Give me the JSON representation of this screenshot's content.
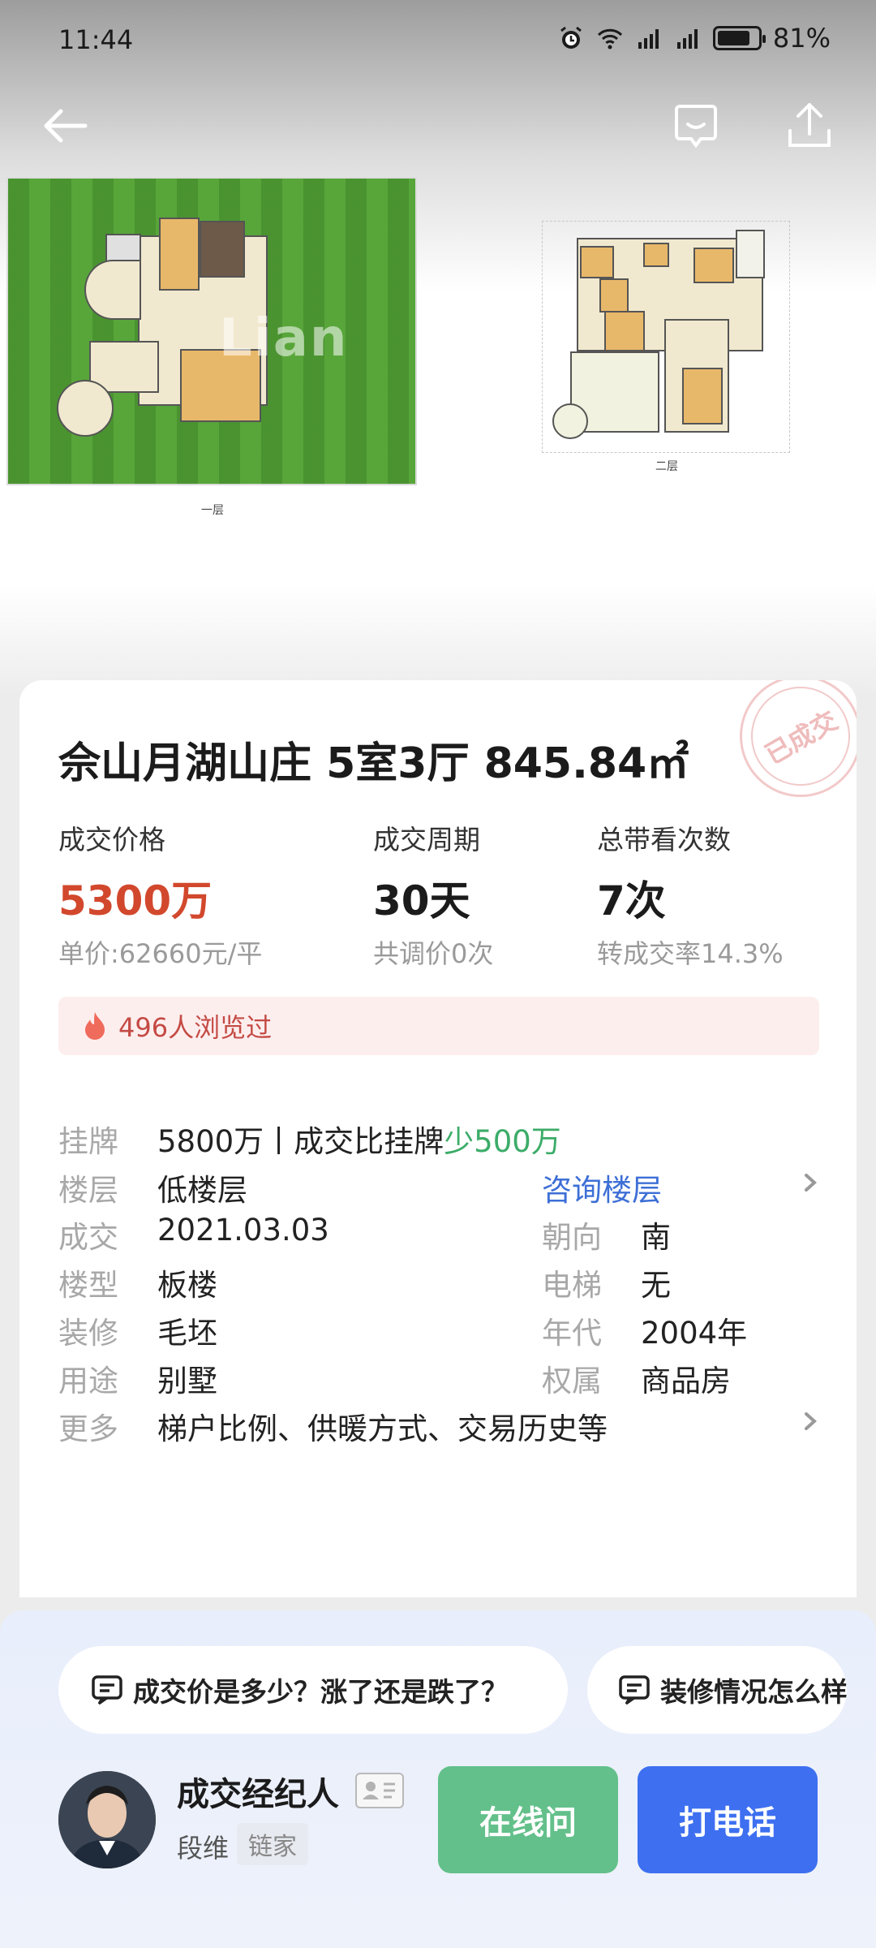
{
  "status_bar": {
    "time": "11:44",
    "battery": "81%",
    "battery_level": 0.81,
    "icons": [
      "alarm-icon",
      "wifi-icon",
      "signal-4g-icon",
      "signal-4g-icon",
      "battery-icon"
    ]
  },
  "topbar": {
    "back_icon": "back-arrow-icon",
    "chat_icon": "chat-icon",
    "share_icon": "share-icon"
  },
  "floorplans": {
    "plan1_caption": "一层",
    "plan2_caption": "二层",
    "watermark": "Lian"
  },
  "listing": {
    "stamp": "已成交",
    "title": "佘山月湖山庄 5室3厅 845.84㎡",
    "stats": [
      {
        "label": "成交价格",
        "value": "5300万",
        "sub": "单价:62660元/平"
      },
      {
        "label": "成交周期",
        "value": "30天",
        "sub": "共调价0次"
      },
      {
        "label": "总带看次数",
        "value": "7次",
        "sub": "转成交率14.3%"
      }
    ],
    "views": "496人浏览过",
    "listing_price": {
      "key": "挂牌",
      "value_prefix": "5800万丨成交比挂牌",
      "value_highlight": "少500万"
    },
    "details": {
      "floor_key": "楼层",
      "floor_value": "低楼层",
      "floor_link": "咨询楼层",
      "deal_key": "成交",
      "deal_value": "2021.03.03",
      "orient_key": "朝向",
      "orient_value": "南",
      "type_key": "楼型",
      "type_value": "板楼",
      "elevator_key": "电梯",
      "elevator_value": "无",
      "deco_key": "装修",
      "deco_value": "毛坯",
      "year_key": "年代",
      "year_value": "2004年",
      "use_key": "用途",
      "use_value": "别墅",
      "own_key": "权属",
      "own_value": "商品房",
      "more_key": "更多",
      "more_value": "梯户比例、供暖方式、交易历史等"
    }
  },
  "bottom": {
    "chips": [
      "成交价是多少？涨了还是跌了？",
      "装修情况怎么样"
    ],
    "agent_title": "成交经纪人",
    "agent_name": "段维",
    "agent_company": "链家",
    "btn_online": "在线问",
    "btn_call": "打电话"
  },
  "colors": {
    "price_red": "#d2482d",
    "link_blue": "#3d6fd6",
    "discount_green": "#3cac68",
    "online_button": "#63c08a",
    "call_button": "#3d6ff0"
  }
}
